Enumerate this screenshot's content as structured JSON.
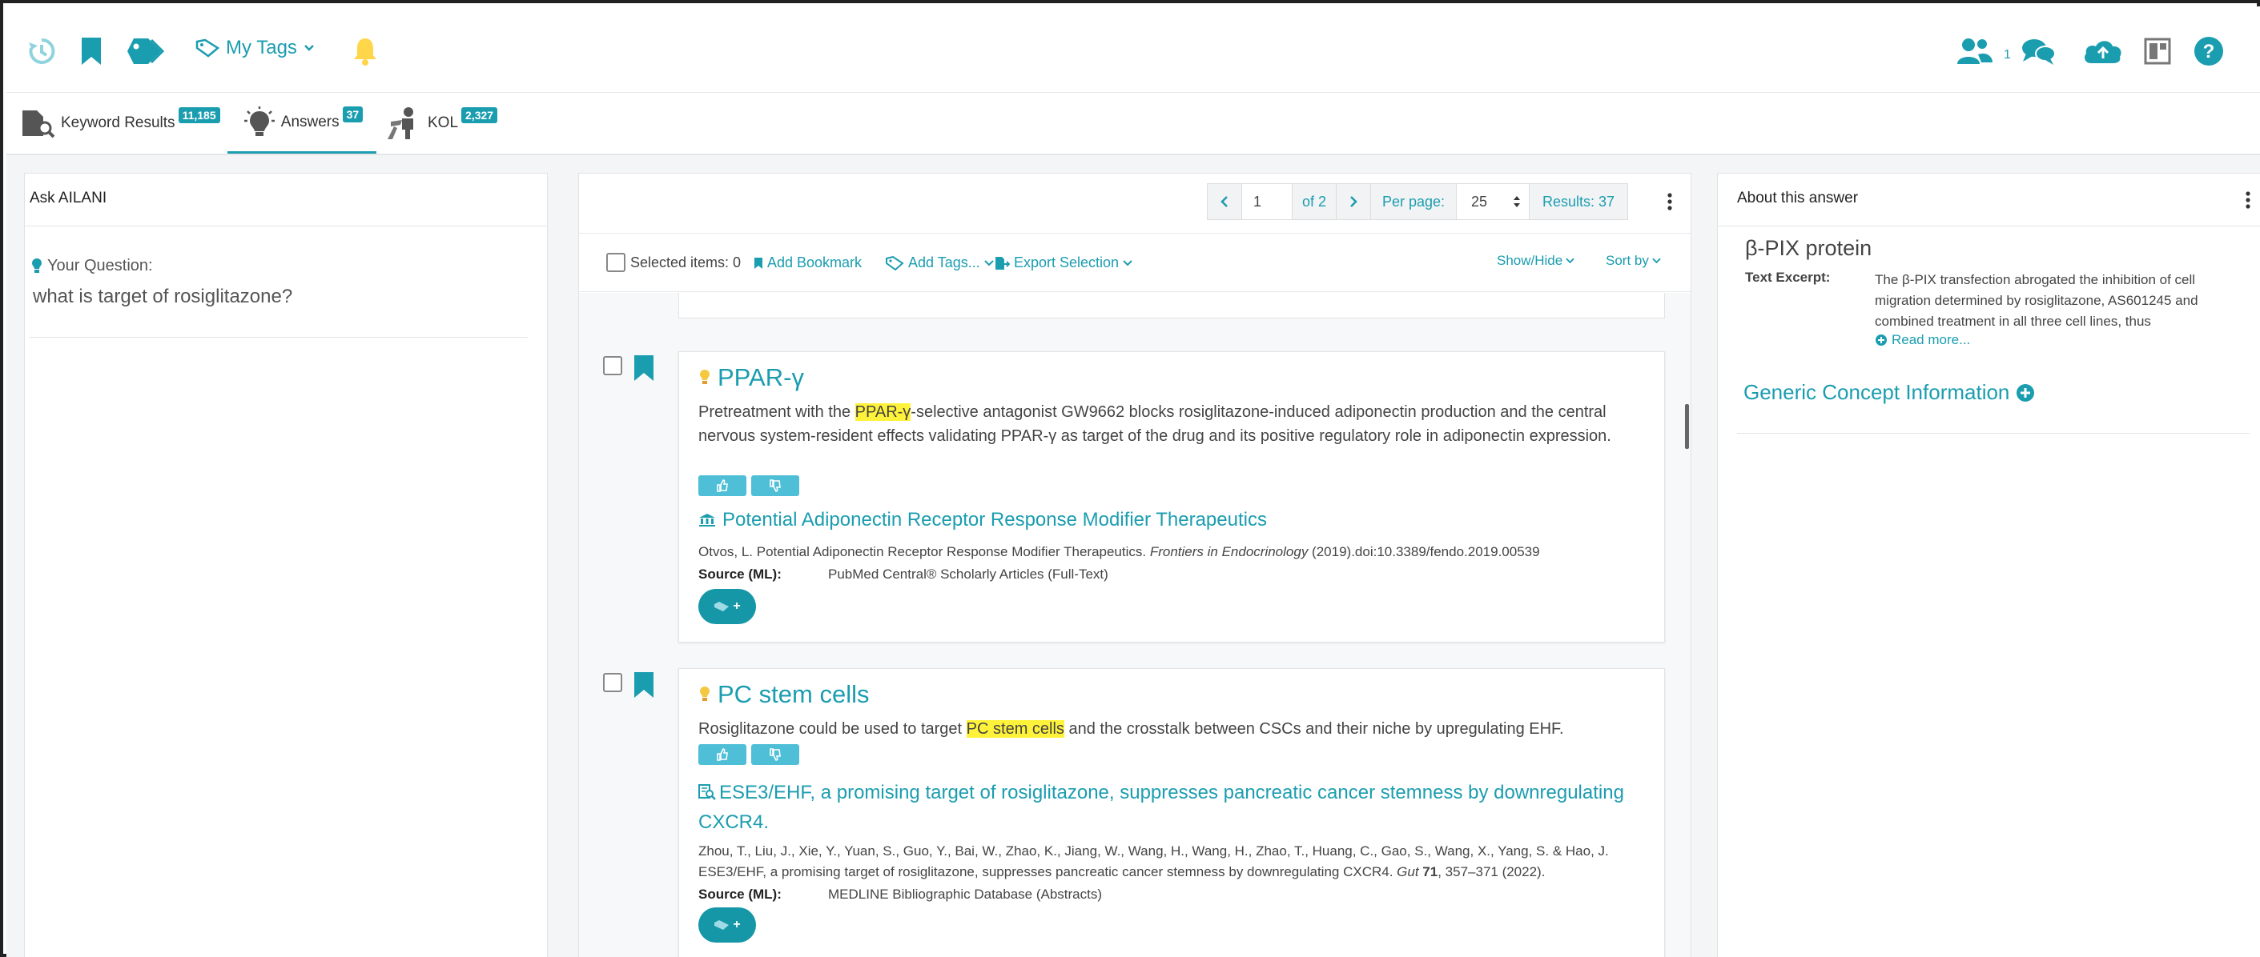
{
  "header": {
    "my_tags_label": "My Tags",
    "collab_count": "1"
  },
  "tabs": [
    {
      "label": "Keyword Results",
      "count": "11,185"
    },
    {
      "label": "Answers",
      "count": "37"
    },
    {
      "label": "KOL",
      "count": "2,327"
    }
  ],
  "left": {
    "title": "Ask AILANI",
    "question_label": "Your Question:",
    "question": "what is target of rosiglitazone?"
  },
  "center": {
    "pagination": {
      "page": "1",
      "of": "of 2",
      "per_page_label": "Per page:",
      "per_page": "25",
      "results": "Results: 37"
    },
    "toolbar": {
      "selected": "Selected items: 0",
      "add_bookmark": "Add Bookmark",
      "add_tags": "Add Tags...",
      "export": "Export Selection",
      "show_hide": "Show/Hide",
      "sort_by": "Sort by"
    },
    "results": [
      {
        "title": "PPAR-γ",
        "snippet_pre": "Pretreatment with the ",
        "snippet_hl": "PPAR-γ",
        "snippet_post": "-selective antagonist GW9662 blocks rosiglitazone-induced adiponectin production and the central nervous system-resident effects validating PPAR-γ as target of the drug and its positive regulatory role in adiponectin expression.",
        "doc_title": "Potential Adiponectin Receptor Response Modifier Therapeutics",
        "cite_pre": "Otvos, L. Potential Adiponectin Receptor Response Modifier Therapeutics. ",
        "cite_journal": "Frontiers in Endocrinology",
        "cite_post": " (2019).doi:10.3389/fendo.2019.00539",
        "source_label": "Source (ML):",
        "source": "PubMed Central® Scholarly Articles (Full-Text)"
      },
      {
        "title": "PC stem cells",
        "snippet_pre": "Rosiglitazone could be used to target ",
        "snippet_hl": "PC stem cells",
        "snippet_post": " and the crosstalk between CSCs and their niche by upregulating EHF.",
        "doc_title": "ESE3/EHF, a promising target of rosiglitazone, suppresses pancreatic cancer stemness by downregulating CXCR4.",
        "cite_line1": "Zhou, T., Liu, J., Xie, Y., Yuan, S., Guo, Y., Bai, W., Zhao, K., Jiang, W., Wang, H., Wang, H., Zhao, T., Huang, C., Gao, S., Wang, X., Yang, S. & Hao, J.",
        "cite_line2_pre": "ESE3/EHF, a promising target of rosiglitazone, suppresses pancreatic cancer stemness by downregulating CXCR4. ",
        "cite_journal": "Gut",
        "cite_volume": "71",
        "cite_post": ", 357–371 (2022).",
        "source_label": "Source (ML):",
        "source": "MEDLINE Bibliographic Database (Abstracts)"
      }
    ],
    "tag_plus": "+"
  },
  "right": {
    "title": "About this answer",
    "concept": "β-PIX protein",
    "excerpt_label": "Text Excerpt:",
    "excerpt_l1": "The β-PIX transfection abrogated the inhibition of cell",
    "excerpt_l2": "migration determined by rosiglitazone, AS601245 and",
    "excerpt_l3": "combined treatment in all three cell lines, thus",
    "read_more": "Read more...",
    "generic_title": "Generic Concept Information"
  },
  "colors": {
    "accent": "#1b9db0",
    "highlight": "#fff23a",
    "vote": "#4ebfd7"
  }
}
